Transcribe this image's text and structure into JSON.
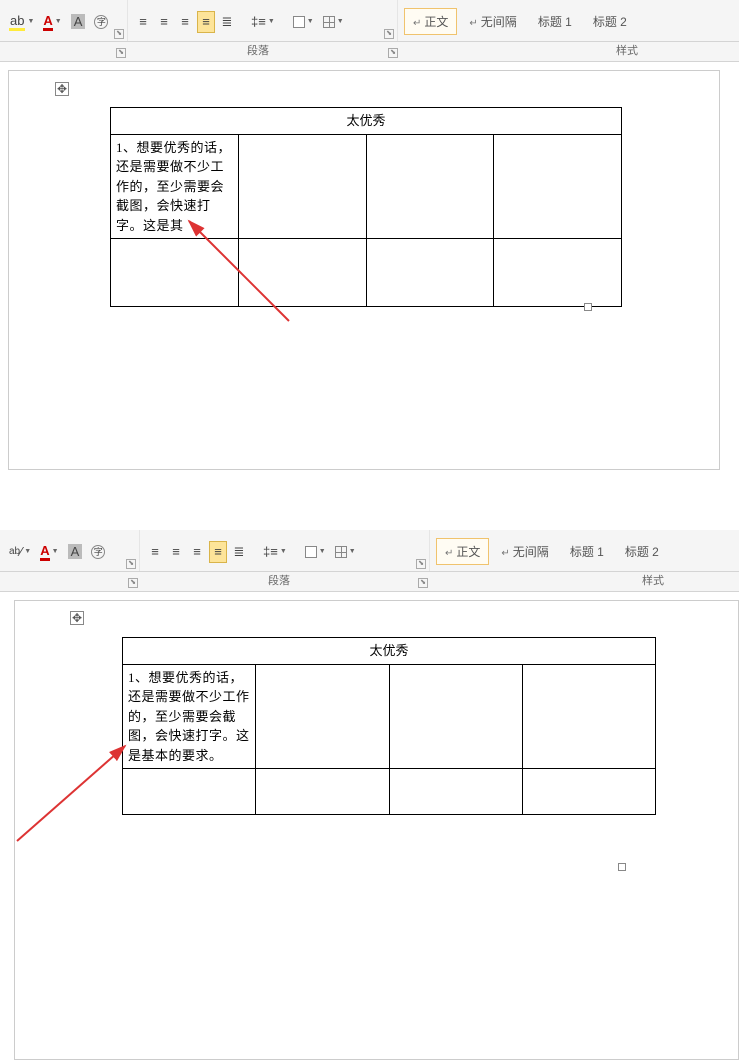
{
  "ribbon": {
    "paragraph_label": "段落",
    "styles_label": "样式",
    "styles": {
      "normal": "正文",
      "nospace": "无间隔",
      "h1": "标题 1",
      "h2": "标题 2"
    }
  },
  "doc": {
    "title": "太优秀",
    "cell_truncated": "1、想要优秀的话，还是需要做不少工作的，至少需要会截图，会快速打字。这是其",
    "cell_full": "1、想要优秀的话，还是需要做不少工作的，至少需要会截图，会快速打字。这是基本的要求。"
  }
}
